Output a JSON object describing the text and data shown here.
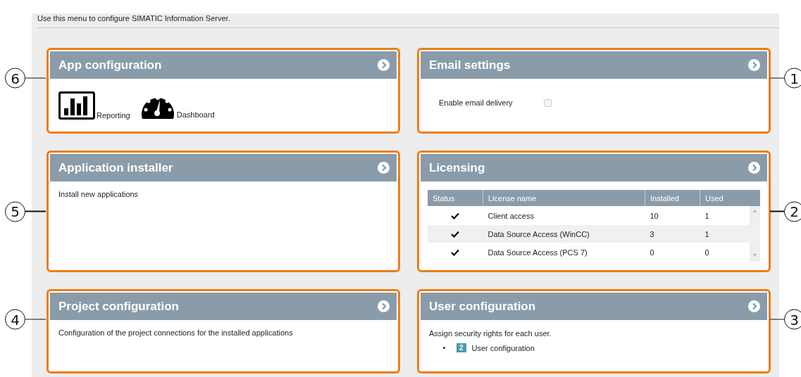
{
  "intro": "Use this menu to configure SIMATIC Information Server.",
  "cards": [
    {
      "kind": "apps",
      "title": "App configuration",
      "callout": "6",
      "apps": [
        {
          "kind": "report",
          "label": "Reporting"
        },
        {
          "kind": "gauge",
          "label": "Dashboard"
        }
      ]
    },
    {
      "kind": "email",
      "title": "Email settings",
      "callout": "1",
      "option": {
        "label": "Enable email delivery",
        "checked": false
      }
    },
    {
      "kind": "text",
      "title": "Application installer",
      "callout": "5",
      "text": "Install new applications"
    },
    {
      "kind": "licensing",
      "title": "Licensing",
      "callout": "2",
      "columns": [
        "Status",
        "License name",
        "Installed",
        "Used"
      ],
      "rows": [
        {
          "valid": true,
          "name": "Client access",
          "installed": "10",
          "used": "1"
        },
        {
          "valid": true,
          "name": "Data Source Access (WinCC)",
          "installed": "3",
          "used": "1"
        },
        {
          "valid": true,
          "name": "Data Source Access (PCS 7)",
          "installed": "0",
          "used": "0"
        }
      ]
    },
    {
      "kind": "text",
      "title": "Project configuration",
      "callout": "4",
      "text": "Configuration of the project connections for the installed applications"
    },
    {
      "kind": "users",
      "title": "User configuration",
      "callout": "3",
      "text": "Assign security rights for each user.",
      "links": [
        {
          "badge": "2",
          "label": "User configuration"
        }
      ]
    }
  ]
}
